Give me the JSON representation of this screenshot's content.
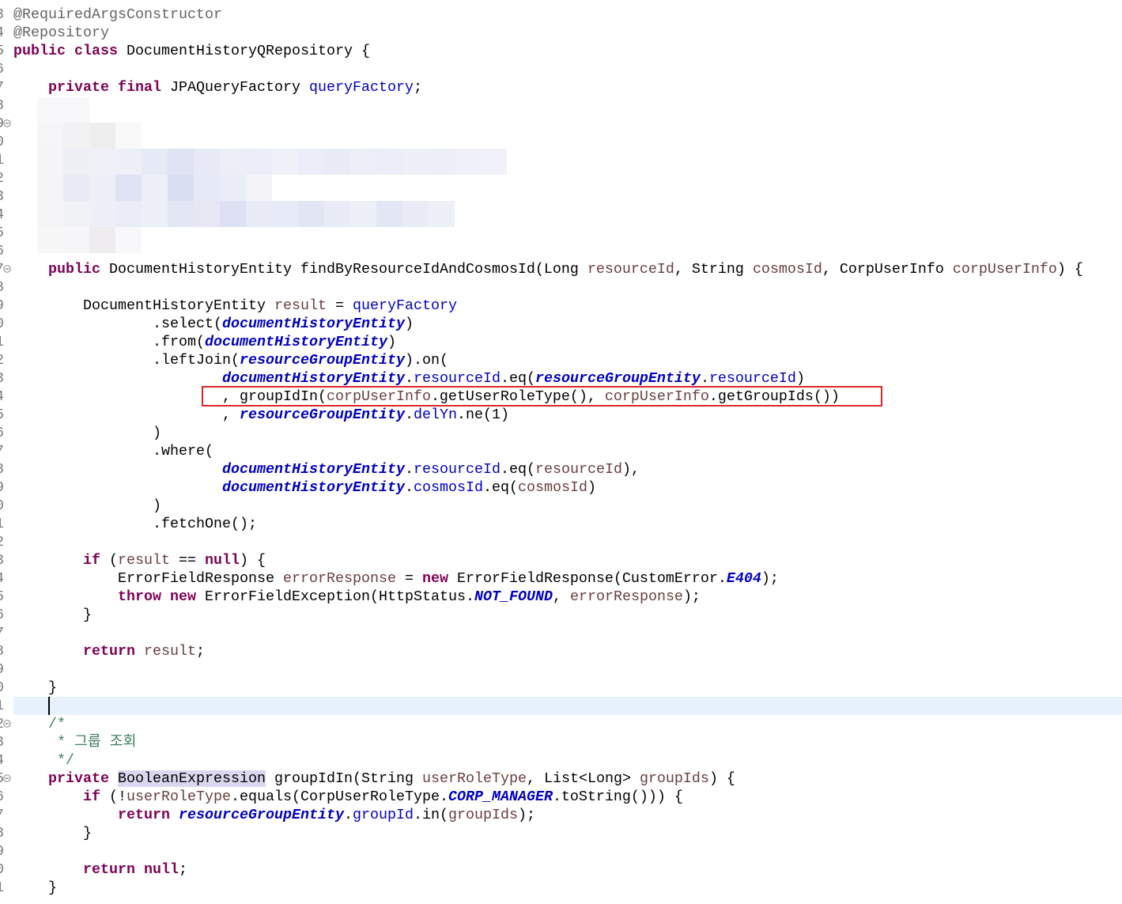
{
  "editor": {
    "syntax_colors": {
      "plain": "#000000",
      "keyword": "#7F0055",
      "annotation": "#646464",
      "field": "#0000C0",
      "static_field": "#0000C0",
      "local": "#6A3E3E",
      "comment": "#3F7F5F",
      "occurrence_bg": "#DAD8EE",
      "current_line_bg": "#E8F2FE",
      "line_number": "#787878",
      "callout_box": "#E0262A"
    },
    "lines": [
      {
        "num": "3",
        "tokens": [
          {
            "annotation": "@RequiredArgsConstructor"
          }
        ]
      },
      {
        "num": "4",
        "tokens": [
          {
            "annotation": "@Repository"
          }
        ]
      },
      {
        "num": "5",
        "tokens": [
          {
            "keyword": "public class"
          },
          {
            "plain": " DocumentHistoryQRepository {"
          }
        ]
      },
      {
        "num": "6",
        "tokens": []
      },
      {
        "num": "7",
        "tokens": [
          {
            "plain": "\t"
          },
          {
            "keyword": "private final"
          },
          {
            "plain": " JPAQueryFactory "
          },
          {
            "field": "queryFactory"
          },
          {
            "plain": ";"
          }
        ]
      },
      {
        "num": "8",
        "tokens": []
      },
      {
        "num": "9",
        "fold": true,
        "tokens": []
      },
      {
        "num": "0",
        "tokens": []
      },
      {
        "num": "1",
        "tokens": []
      },
      {
        "num": "2",
        "tokens": []
      },
      {
        "num": "3",
        "tokens": []
      },
      {
        "num": "4",
        "tokens": []
      },
      {
        "num": "5",
        "tokens": []
      },
      {
        "num": "6",
        "tokens": []
      },
      {
        "num": "7",
        "fold": true,
        "tokens": [
          {
            "plain": "\t"
          },
          {
            "keyword": "public"
          },
          {
            "plain": " DocumentHistoryEntity findByResourceIdAndCosmosId(Long "
          },
          {
            "local": "resourceId"
          },
          {
            "plain": ", String "
          },
          {
            "local": "cosmosId"
          },
          {
            "plain": ", CorpUserInfo "
          },
          {
            "local": "corpUserInfo"
          },
          {
            "plain": ") {"
          }
        ]
      },
      {
        "num": "8",
        "tokens": []
      },
      {
        "num": "9",
        "tokens": [
          {
            "plain": "\t\tDocumentHistoryEntity "
          },
          {
            "local": "result"
          },
          {
            "plain": " = "
          },
          {
            "field": "queryFactory"
          }
        ]
      },
      {
        "num": "0",
        "tokens": [
          {
            "plain": "\t\t\t\t.select("
          },
          {
            "static_field": "documentHistoryEntity"
          },
          {
            "plain": ")"
          }
        ]
      },
      {
        "num": "1",
        "tokens": [
          {
            "plain": "\t\t\t\t.from("
          },
          {
            "static_field": "documentHistoryEntity"
          },
          {
            "plain": ")"
          }
        ]
      },
      {
        "num": "2",
        "tokens": [
          {
            "plain": "\t\t\t\t.leftJoin("
          },
          {
            "static_field": "resourceGroupEntity"
          },
          {
            "plain": ").on("
          }
        ]
      },
      {
        "num": "3",
        "tokens": [
          {
            "plain": "\t\t\t\t\t\t"
          },
          {
            "static_field": "documentHistoryEntity"
          },
          {
            "plain": "."
          },
          {
            "field": "resourceId"
          },
          {
            "plain": ".eq("
          },
          {
            "static_field": "resourceGroupEntity"
          },
          {
            "plain": "."
          },
          {
            "field": "resourceId"
          },
          {
            "plain": ")"
          }
        ]
      },
      {
        "num": "4",
        "tokens": [
          {
            "plain": "\t\t\t\t\t\t, groupIdIn("
          },
          {
            "local": "corpUserInfo"
          },
          {
            "plain": ".getUserRoleType(), "
          },
          {
            "local": "corpUserInfo"
          },
          {
            "plain": ".getGroupIds())"
          }
        ]
      },
      {
        "num": "5",
        "tokens": [
          {
            "plain": "\t\t\t\t\t\t, "
          },
          {
            "static_field": "resourceGroupEntity"
          },
          {
            "plain": "."
          },
          {
            "field": "delYn"
          },
          {
            "plain": ".ne(1)"
          }
        ]
      },
      {
        "num": "6",
        "tokens": [
          {
            "plain": "\t\t\t\t)"
          }
        ]
      },
      {
        "num": "7",
        "tokens": [
          {
            "plain": "\t\t\t\t.where("
          }
        ]
      },
      {
        "num": "8",
        "tokens": [
          {
            "plain": "\t\t\t\t\t\t"
          },
          {
            "static_field": "documentHistoryEntity"
          },
          {
            "plain": "."
          },
          {
            "field": "resourceId"
          },
          {
            "plain": ".eq("
          },
          {
            "local": "resourceId"
          },
          {
            "plain": "),"
          }
        ]
      },
      {
        "num": "9",
        "tokens": [
          {
            "plain": "\t\t\t\t\t\t"
          },
          {
            "static_field": "documentHistoryEntity"
          },
          {
            "plain": "."
          },
          {
            "field": "cosmosId"
          },
          {
            "plain": ".eq("
          },
          {
            "local": "cosmosId"
          },
          {
            "plain": ")"
          }
        ]
      },
      {
        "num": "0",
        "tokens": [
          {
            "plain": "\t\t\t\t)"
          }
        ]
      },
      {
        "num": "1",
        "tokens": [
          {
            "plain": "\t\t\t\t.fetchOne();"
          }
        ]
      },
      {
        "num": "2",
        "tokens": []
      },
      {
        "num": "3",
        "tokens": [
          {
            "plain": "\t\t"
          },
          {
            "keyword": "if"
          },
          {
            "plain": " ("
          },
          {
            "local": "result"
          },
          {
            "plain": " == "
          },
          {
            "keyword": "null"
          },
          {
            "plain": ") {"
          }
        ]
      },
      {
        "num": "4",
        "tokens": [
          {
            "plain": "\t\t\tErrorFieldResponse "
          },
          {
            "local": "errorResponse"
          },
          {
            "plain": " = "
          },
          {
            "keyword": "new"
          },
          {
            "plain": " ErrorFieldResponse(CustomError."
          },
          {
            "static_field": "E404"
          },
          {
            "plain": ");"
          }
        ]
      },
      {
        "num": "5",
        "tokens": [
          {
            "plain": "\t\t\t"
          },
          {
            "keyword": "throw new"
          },
          {
            "plain": " ErrorFieldException(HttpStatus."
          },
          {
            "static_field": "NOT_FOUND"
          },
          {
            "plain": ", "
          },
          {
            "local": "errorResponse"
          },
          {
            "plain": ");"
          }
        ]
      },
      {
        "num": "6",
        "tokens": [
          {
            "plain": "\t\t}"
          }
        ]
      },
      {
        "num": "7",
        "tokens": []
      },
      {
        "num": "8",
        "tokens": [
          {
            "plain": "\t\t"
          },
          {
            "keyword": "return"
          },
          {
            "plain": " "
          },
          {
            "local": "result"
          },
          {
            "plain": ";"
          }
        ]
      },
      {
        "num": "9",
        "tokens": []
      },
      {
        "num": "0",
        "tokens": [
          {
            "plain": "\t}"
          }
        ]
      },
      {
        "num": "1",
        "current": true,
        "tokens": [
          {
            "plain": "\t"
          }
        ]
      },
      {
        "num": "2",
        "fold": true,
        "tokens": [
          {
            "plain": "\t"
          },
          {
            "comment": "/*"
          }
        ]
      },
      {
        "num": "3",
        "tokens": [
          {
            "plain": "\t"
          },
          {
            "comment": " * 그룹 조회"
          }
        ]
      },
      {
        "num": "4",
        "tokens": [
          {
            "plain": "\t"
          },
          {
            "comment": " */"
          }
        ]
      },
      {
        "num": "5",
        "fold": true,
        "tokens": [
          {
            "plain": "\t"
          },
          {
            "keyword": "private"
          },
          {
            "plain": " "
          },
          {
            "occurrence": "BooleanExpression"
          },
          {
            "plain": " groupIdIn(String "
          },
          {
            "local": "userRoleType"
          },
          {
            "plain": ", List<Long> "
          },
          {
            "local": "groupIds"
          },
          {
            "plain": ") {"
          }
        ]
      },
      {
        "num": "6",
        "tokens": [
          {
            "plain": "\t\t"
          },
          {
            "keyword": "if"
          },
          {
            "plain": " (!"
          },
          {
            "local": "userRoleType"
          },
          {
            "plain": ".equals(CorpUserRoleType."
          },
          {
            "static_field": "CORP_MANAGER"
          },
          {
            "plain": ".toString())) {"
          }
        ]
      },
      {
        "num": "7",
        "tokens": [
          {
            "plain": "\t\t\t"
          },
          {
            "keyword": "return"
          },
          {
            "plain": " "
          },
          {
            "static_field": "resourceGroupEntity"
          },
          {
            "plain": "."
          },
          {
            "field": "groupId"
          },
          {
            "plain": ".in("
          },
          {
            "local": "groupIds"
          },
          {
            "plain": ");"
          }
        ]
      },
      {
        "num": "8",
        "tokens": [
          {
            "plain": "\t\t}"
          }
        ]
      },
      {
        "num": "9",
        "tokens": []
      },
      {
        "num": "0",
        "tokens": [
          {
            "plain": "\t\t"
          },
          {
            "keyword": "return"
          },
          {
            "plain": " "
          },
          {
            "keyword": "null"
          },
          {
            "plain": ";"
          }
        ]
      },
      {
        "num": "1",
        "tokens": [
          {
            "plain": "\t}"
          }
        ]
      }
    ]
  }
}
